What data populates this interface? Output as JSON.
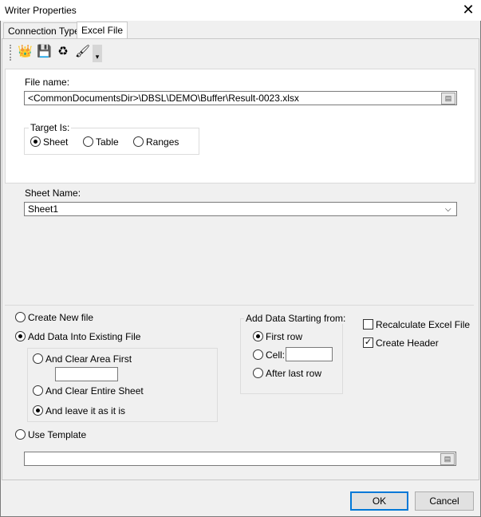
{
  "window": {
    "title": "Writer Properties"
  },
  "tabs": [
    {
      "label": "Connection Type"
    },
    {
      "label": "Excel File"
    }
  ],
  "toolbar": {
    "icons": [
      "crown-icon",
      "save-icon",
      "refresh-icon",
      "brush-icon"
    ],
    "more": "▾"
  },
  "file": {
    "label": "File name:",
    "value": "<CommonDocumentsDir>\\DBSL\\DEMO\\Buffer\\Result-0023.xlsx"
  },
  "target": {
    "legend": "Target Is:",
    "options": [
      "Sheet",
      "Table",
      "Ranges"
    ],
    "selected": "Sheet"
  },
  "sheet": {
    "label": "Sheet Name:",
    "value": "Sheet1"
  },
  "mode": {
    "create_new": "Create New file",
    "add_existing": "Add Data Into Existing File",
    "clear_area": "And Clear Area First",
    "clear_sheet": "And Clear Entire Sheet",
    "leave": "And leave it as it is",
    "use_template": "Use Template"
  },
  "start": {
    "legend": "Add Data Starting from:",
    "first_row": "First row",
    "cell": "Cell:",
    "after_last": "After last row"
  },
  "options": {
    "recalculate": "Recalculate Excel File",
    "create_header": "Create Header"
  },
  "buttons": {
    "ok": "OK",
    "cancel": "Cancel"
  }
}
